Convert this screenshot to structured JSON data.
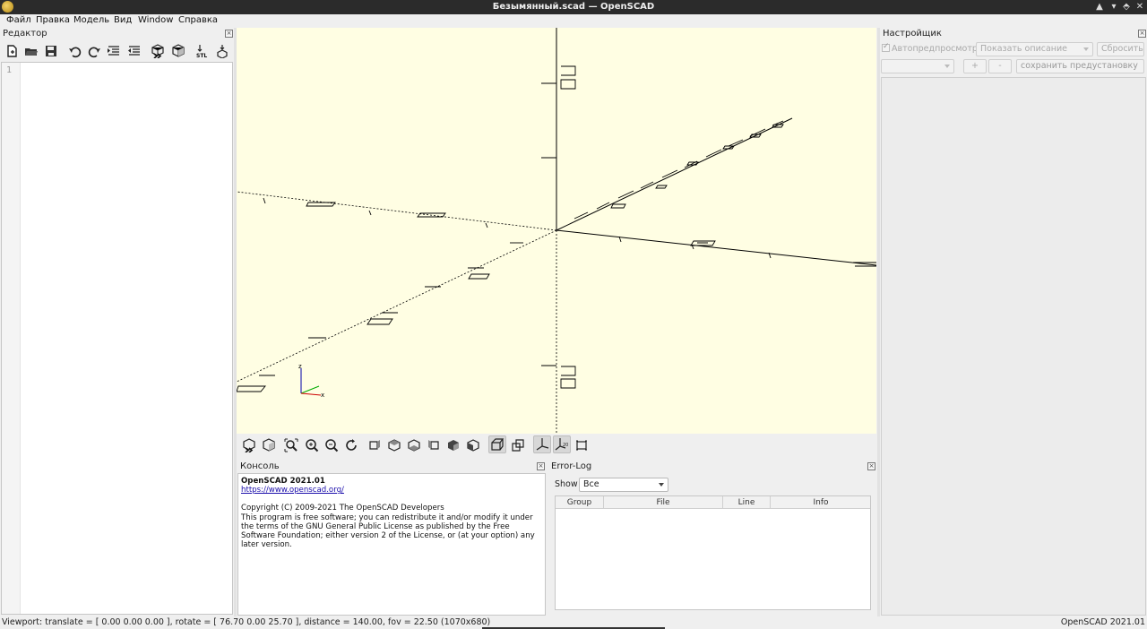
{
  "window": {
    "title": "Безымянный.scad — OpenSCAD",
    "controls": [
      "▲",
      "▾",
      "⬘",
      "✕"
    ]
  },
  "menu": [
    {
      "label": "Файл"
    },
    {
      "label": "Правка"
    },
    {
      "label": "Модель"
    },
    {
      "label": "Вид"
    },
    {
      "label": "Window"
    },
    {
      "label": "Справка"
    }
  ],
  "editor": {
    "title": "Редактор",
    "line_number": "1",
    "toolbar_icons": [
      "new-file-icon",
      "open-file-icon",
      "save-icon",
      "undo-icon",
      "redo-icon",
      "indent-icon",
      "unindent-icon",
      "preview-icon",
      "render-icon",
      "export-stl-icon",
      "send-to-print-icon"
    ]
  },
  "view_toolbar_icons": [
    "preview-icon",
    "render-icon",
    "zoom-all-icon",
    "zoom-in-icon",
    "zoom-out-icon",
    "reset-view-icon",
    "view-right-icon",
    "view-top-icon",
    "view-bottom-icon",
    "view-left-icon",
    "view-front-icon",
    "view-back-icon",
    "perspective-icon",
    "orthogonal-icon",
    "show-axes-icon",
    "show-scale-icon",
    "show-edges-icon"
  ],
  "console": {
    "title": "Консоль",
    "version": "OpenSCAD 2021.01",
    "url": "https://www.openscad.org/",
    "copyright": "Copyright (C) 2009-2021 The OpenSCAD Developers",
    "license": "This program is free software; you can redistribute it and/or modify it under the terms of the GNU General Public License as published by the Free Software Foundation; either version 2 of the License, or (at your option) any later version."
  },
  "error_log": {
    "title": "Error-Log",
    "show_label": "Show",
    "show_value": "Все",
    "columns": [
      "Group",
      "File",
      "Line",
      "Info"
    ]
  },
  "customizer": {
    "title": "Настройщик",
    "auto_preview": "Автопредпросмотр",
    "description_select": "Показать описание",
    "reset_button": "Сбросить",
    "add_button": "+",
    "remove_button": "-",
    "save_preset_button": "сохранить предустановку"
  },
  "viewport": {
    "axis_labels": {
      "z": "z",
      "y": "y",
      "x": "x"
    }
  },
  "status": {
    "viewport_info": "Viewport: translate = [ 0.00 0.00 0.00 ], rotate = [ 76.70 0.00 25.70 ], distance = 140.00, fov = 22.50 (1070x680)",
    "version": "OpenSCAD 2021.01"
  }
}
